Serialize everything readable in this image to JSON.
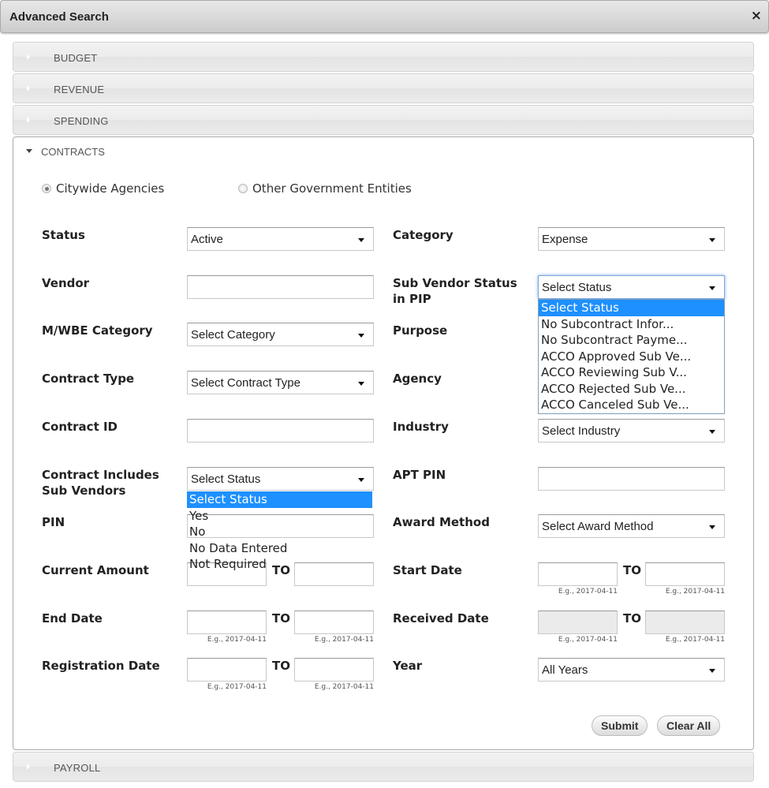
{
  "dialog": {
    "title": "Advanced Search",
    "close_icon": "×"
  },
  "accordion": {
    "budget": "BUDGET",
    "revenue": "REVENUE",
    "spending": "SPENDING",
    "contracts": "CONTRACTS",
    "payroll": "PAYROLL"
  },
  "contracts": {
    "entity_options": [
      {
        "label": "Citywide Agencies",
        "checked": true
      },
      {
        "label": "Other Government Entities",
        "checked": false
      }
    ],
    "fields": {
      "status": {
        "label": "Status",
        "value": "Active"
      },
      "category": {
        "label": "Category",
        "value": "Expense"
      },
      "vendor": {
        "label": "Vendor",
        "value": ""
      },
      "sub_vendor_status": {
        "label": "Sub Vendor Status in PIP",
        "value": "Select Status",
        "options": [
          "Select Status",
          "No Subcontract Infor...",
          "No Subcontract Payme...",
          "ACCO Approved Sub Ve...",
          "ACCO Reviewing Sub V...",
          "ACCO Rejected Sub Ve...",
          "ACCO Canceled Sub Ve..."
        ],
        "highlighted_option": "Select Status"
      },
      "mwbe_category": {
        "label": "M/WBE Category",
        "value": "Select Category"
      },
      "purpose": {
        "label": "Purpose",
        "value": ""
      },
      "contract_type": {
        "label": "Contract Type",
        "value": "Select Contract Type"
      },
      "agency": {
        "label": "Agency",
        "value": ""
      },
      "contract_id": {
        "label": "Contract ID",
        "value": ""
      },
      "industry": {
        "label": "Industry",
        "value": "Select Industry"
      },
      "includes_sub_vendors": {
        "label": "Contract Includes Sub Vendors",
        "value": "Select Status",
        "options": [
          "Select Status",
          "Yes",
          "No",
          "No Data Entered",
          "Not Required"
        ],
        "highlighted_option": "Select Status"
      },
      "apt_pin": {
        "label": "APT PIN",
        "value": ""
      },
      "pin": {
        "label": "PIN",
        "value": ""
      },
      "award_method": {
        "label": "Award Method",
        "value": "Select Award Method"
      },
      "current_amount": {
        "label": "Current Amount",
        "to": "TO",
        "from_value": "",
        "to_value": ""
      },
      "start_date": {
        "label": "Start Date",
        "to": "TO",
        "hint": "E.g., 2017-04-11"
      },
      "end_date": {
        "label": "End Date",
        "to": "TO",
        "hint": "E.g., 2017-04-11"
      },
      "received_date": {
        "label": "Received Date",
        "to": "TO",
        "hint": "E.g., 2017-04-11",
        "disabled": true
      },
      "registration_date": {
        "label": "Registration Date",
        "to": "TO",
        "hint": "E.g., 2017-04-11"
      },
      "year": {
        "label": "Year",
        "value": "All Years"
      }
    },
    "buttons": {
      "submit": "Submit",
      "clear_all": "Clear All"
    }
  }
}
